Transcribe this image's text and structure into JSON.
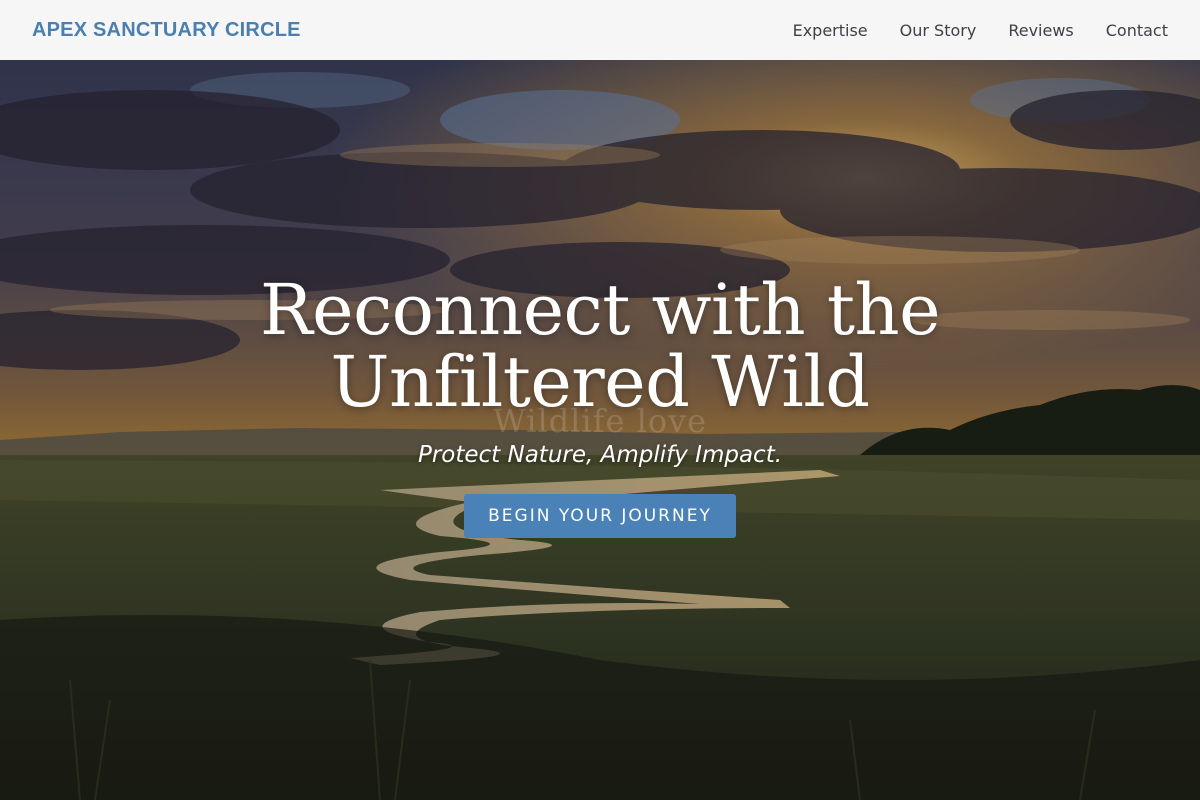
{
  "header": {
    "logo": "APEX SANCTUARY CIRCLE",
    "nav": [
      {
        "label": "Expertise"
      },
      {
        "label": "Our Story"
      },
      {
        "label": "Reviews"
      },
      {
        "label": "Contact"
      }
    ]
  },
  "hero": {
    "title_line1": "Reconnect with the",
    "title_line2": "Unfiltered Wild",
    "watermark": "Wildlife love",
    "subtitle": "Protect Nature, Amplify Impact.",
    "cta_label": "BEGIN YOUR JOURNEY",
    "image_description_icon": "landscape-sunset-photo"
  },
  "colors": {
    "accent": "#4a82b8",
    "logo": "#4a7fb0",
    "header_bg": "#f6f6f7",
    "nav_text": "#3f3f46"
  }
}
